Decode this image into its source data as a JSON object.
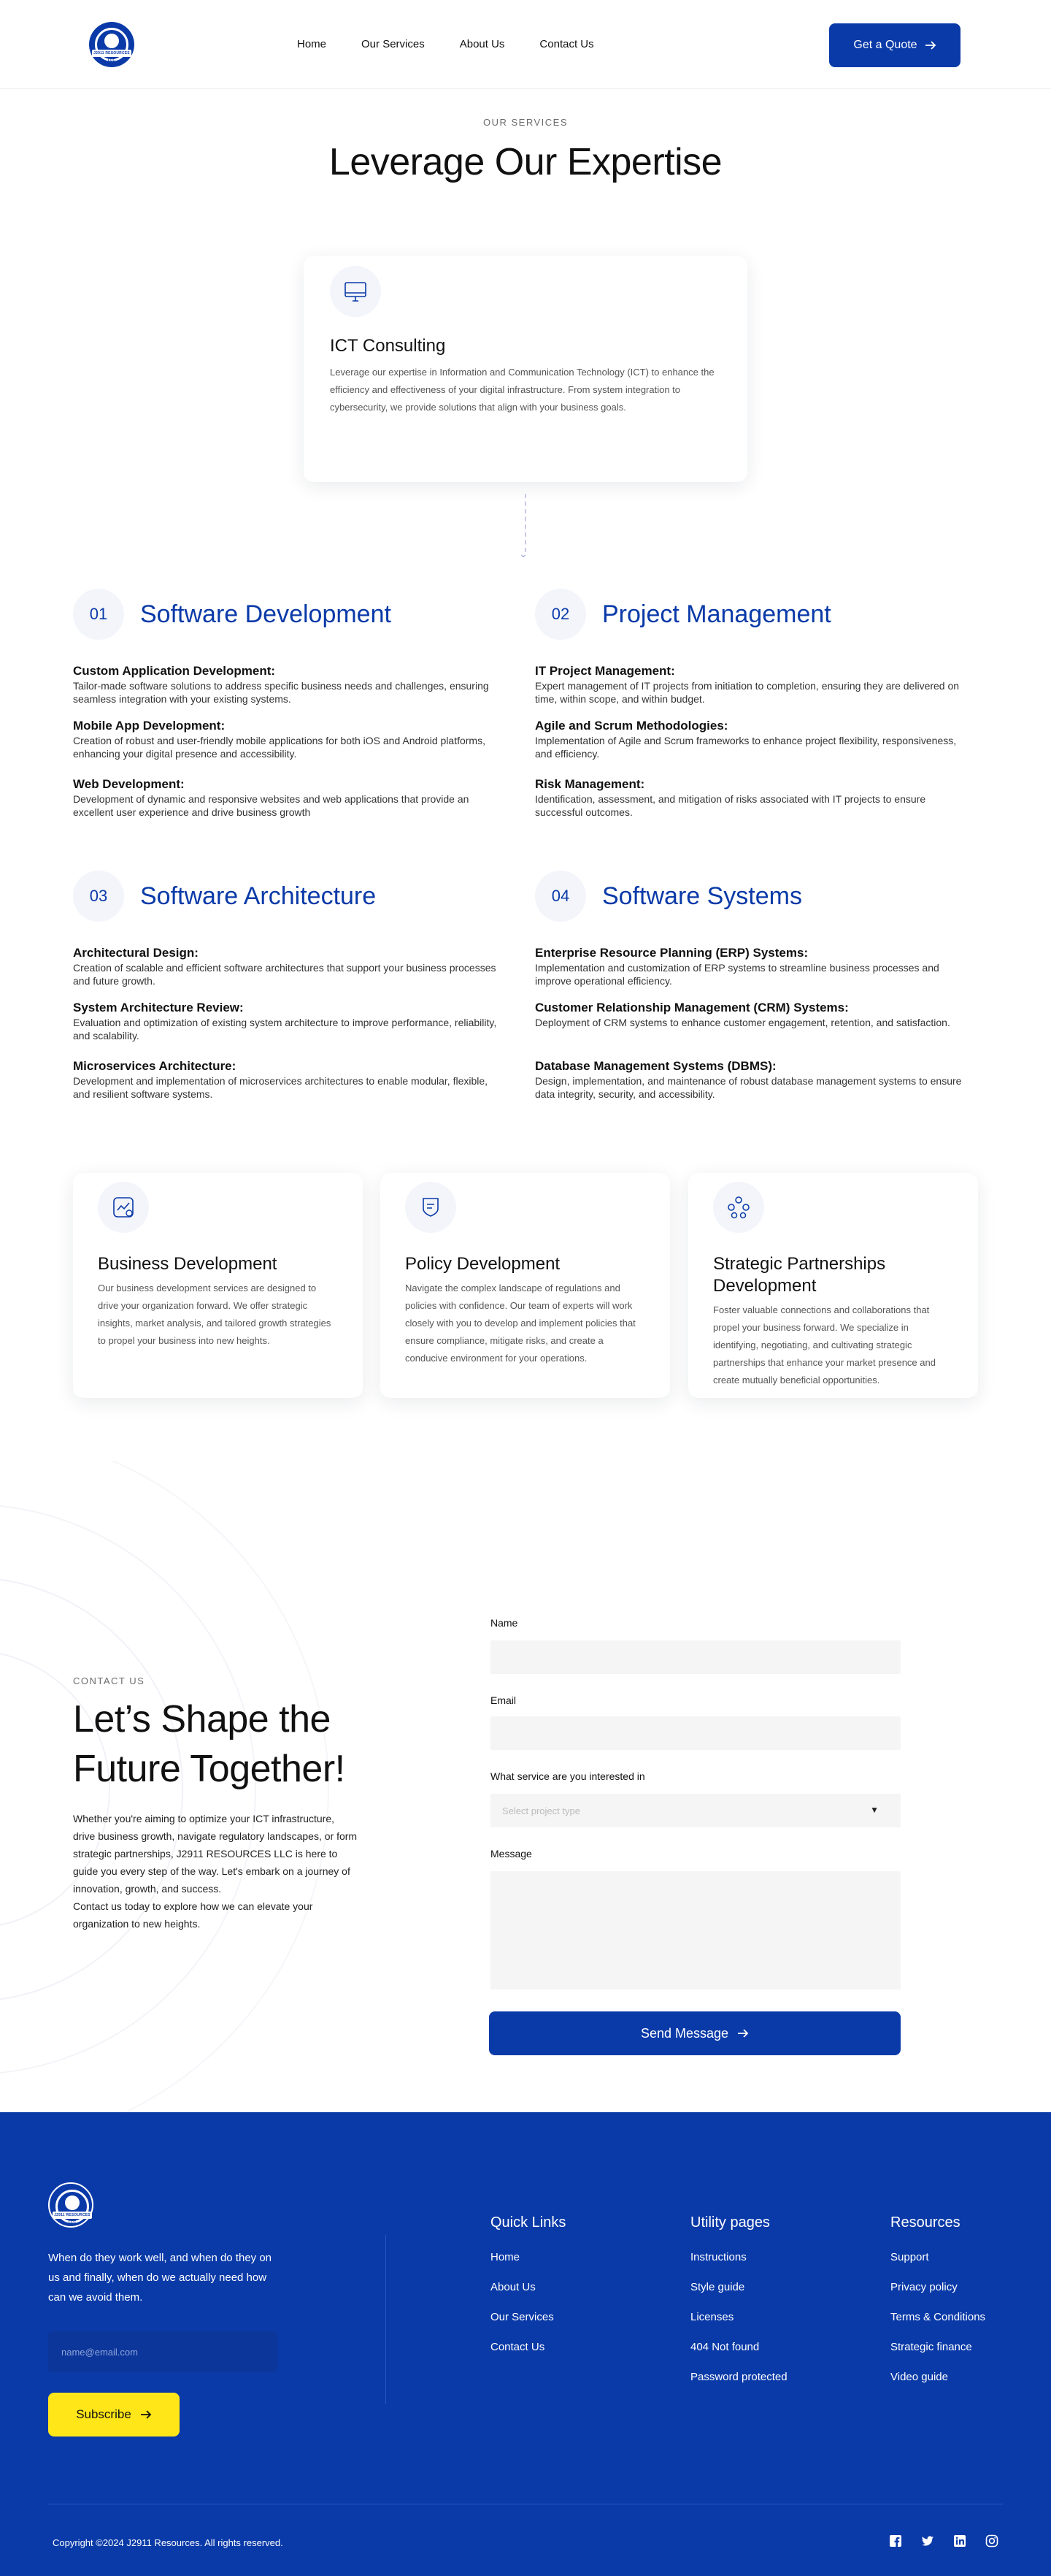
{
  "header": {
    "logo_text": "J2911 RESOURCES LLC",
    "nav": [
      "Home",
      "Our Services",
      "About Us",
      "Contact Us"
    ],
    "cta": "Get a Quote"
  },
  "services": {
    "eyebrow": "OUR SERVICES",
    "title": "Leverage Our Expertise",
    "ict": {
      "title": "ICT Consulting",
      "text": "Leverage our expertise in Information and Communication Technology (ICT) to enhance the efficiency and effectiveness of your digital infrastructure. From system integration to cybersecurity, we provide solutions that align with your business goals."
    },
    "sections": [
      {
        "num": "01",
        "title": "Software Development",
        "items": [
          {
            "title": "Custom Application Development:",
            "desc": "Tailor-made software solutions to address specific business needs and challenges, ensuring seamless integration with your existing systems."
          },
          {
            "title": "Mobile App Development:",
            "desc": "Creation of robust and user-friendly mobile applications for both iOS and Android platforms, enhancing your digital presence and accessibility."
          },
          {
            "title": "Web Development:",
            "desc": "Development of dynamic and responsive websites and web applications that provide an excellent user experience and drive business growth"
          }
        ]
      },
      {
        "num": "02",
        "title": "Project Management",
        "items": [
          {
            "title": "IT Project Management:",
            "desc": "Expert management of IT projects from initiation to completion, ensuring they are delivered on time, within scope, and within budget."
          },
          {
            "title": "Agile and Scrum Methodologies:",
            "desc": "Implementation of Agile and Scrum frameworks to enhance project flexibility, responsiveness, and efficiency."
          },
          {
            "title": "Risk Management:",
            "desc": "Identification, assessment, and mitigation of risks associated with IT projects to ensure successful outcomes."
          }
        ]
      },
      {
        "num": "03",
        "title": "Software Architecture",
        "items": [
          {
            "title": "Architectural Design:",
            "desc": "Creation of scalable and efficient software architectures that support your business processes and future growth."
          },
          {
            "title": "System Architecture Review:",
            "desc": "Evaluation and optimization of existing system architecture to improve performance, reliability, and scalability."
          },
          {
            "title": "Microservices Architecture:",
            "desc": "Development and implementation of microservices architectures to enable modular, flexible, and resilient software systems."
          }
        ]
      },
      {
        "num": "04",
        "title": "Software Systems",
        "items": [
          {
            "title": "Enterprise Resource Planning (ERP) Systems:",
            "desc": "Implementation and customization of ERP systems to streamline business processes and improve operational efficiency."
          },
          {
            "title": "Customer Relationship Management (CRM) Systems:",
            "desc": "Deployment of CRM systems to enhance customer engagement, retention, and satisfaction."
          },
          {
            "title": "Database Management Systems (DBMS):",
            "desc": "Design, implementation, and maintenance of robust database management systems to ensure data integrity, security, and accessibility."
          }
        ]
      }
    ],
    "features": [
      {
        "icon": "chart-icon",
        "title": "Business Development",
        "text": "Our business development services are designed to drive your organization forward. We offer strategic insights, market analysis, and tailored growth strategies to propel your business into new heights."
      },
      {
        "icon": "shield-icon",
        "title": "Policy Development",
        "text": "Navigate the complex landscape of regulations and policies with confidence. Our team of experts will work closely with you to develop and implement policies that ensure compliance, mitigate risks, and create a conducive environment for your operations."
      },
      {
        "icon": "network-icon",
        "title": "Strategic Partnerships Development",
        "text": "Foster valuable connections and collaborations that propel your business forward. We specialize in identifying, negotiating, and cultivating strategic partnerships that enhance your market presence and create mutually beneficial opportunities."
      }
    ]
  },
  "contact": {
    "eyebrow": "CONTACT US",
    "title_line1": "Let’s Shape the",
    "title_line2": "Future Together!",
    "text": "Whether you're aiming to optimize your ICT infrastructure, drive business growth, navigate regulatory landscapes, or form strategic partnerships, J2911 RESOURCES LLC is here to guide you every step of the way. Let's embark on a journey of innovation, growth, and success.",
    "text2": "Contact us today to explore how we can elevate your organization to new heights.",
    "form": {
      "name_label": "Name",
      "email_label": "Email",
      "service_label": "What service are you interested in",
      "service_placeholder": "Select project type",
      "message_label": "Message",
      "submit": "Send Message"
    }
  },
  "footer": {
    "tagline": "When do they work well, and when do they on us and finally, when do we actually need how can we avoid them.",
    "email_placeholder": "name@email.com",
    "subscribe": "Subscribe",
    "columns": [
      {
        "title": "Quick Links",
        "links": [
          "Home",
          "About Us",
          "Our Services",
          "Contact Us"
        ]
      },
      {
        "title": "Utility pages",
        "links": [
          "Instructions",
          "Style guide",
          "Licenses",
          "404 Not found",
          "Password protected"
        ]
      },
      {
        "title": "Resources",
        "links": [
          "Support",
          "Privacy policy",
          "Terms & Conditions",
          "Strategic finance",
          "Video guide"
        ]
      }
    ],
    "copyright": "Copyright ©2024 J2911 Resources. All rights reserved.",
    "socials": [
      "facebook-icon",
      "twitter-icon",
      "linkedin-icon",
      "instagram-icon"
    ]
  },
  "colors": {
    "brand": "#0a3aa8",
    "accent": "#ffe619"
  }
}
